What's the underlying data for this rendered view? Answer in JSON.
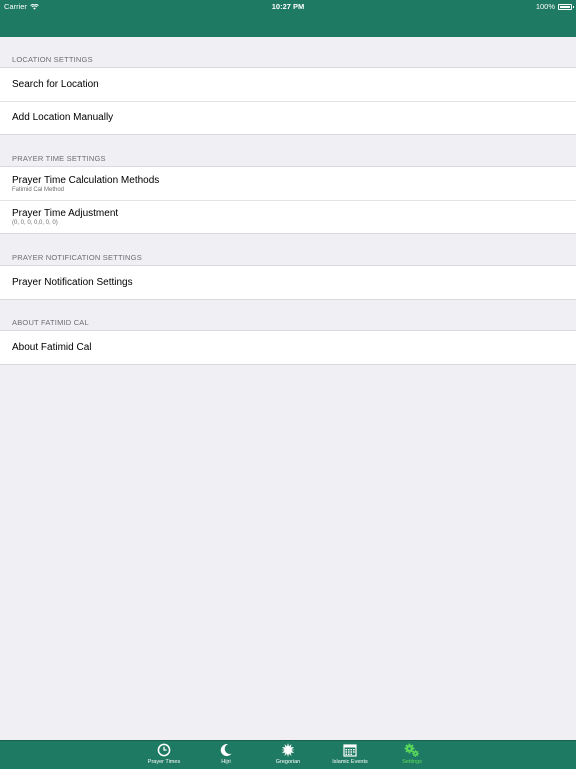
{
  "status_bar": {
    "carrier": "Carrier",
    "time": "10:27 PM",
    "battery": "100%"
  },
  "sections": [
    {
      "header": "LOCATION SETTINGS",
      "items": [
        {
          "title": "Search for Location"
        },
        {
          "title": "Add Location Manually"
        }
      ]
    },
    {
      "header": "PRAYER TIME SETTINGS",
      "items": [
        {
          "title": "Prayer Time Calculation Methods",
          "subtitle": "Fatimid Cal Method"
        },
        {
          "title": "Prayer Time Adjustment",
          "subtitle": "(0, 0, 0, 0,0, 0, 0)"
        }
      ]
    },
    {
      "header": "PRAYER NOTIFICATION SETTINGS",
      "items": [
        {
          "title": "Prayer Notification Settings"
        }
      ]
    },
    {
      "header": "ABOUT FATIMID CAL",
      "items": [
        {
          "title": "About Fatimid Cal"
        }
      ]
    }
  ],
  "tabs": [
    {
      "label": "Prayer Times",
      "icon": "clock-icon"
    },
    {
      "label": "Hijri",
      "icon": "moon-icon"
    },
    {
      "label": "Gregorian",
      "icon": "sun-icon"
    },
    {
      "label": "Islamic Events",
      "icon": "calendar-icon"
    },
    {
      "label": "Settings",
      "icon": "gears-icon",
      "active": true
    }
  ],
  "colors": {
    "bar": "#1f7a63",
    "active_tab": "#5ddc5a",
    "background": "#efeff4"
  }
}
